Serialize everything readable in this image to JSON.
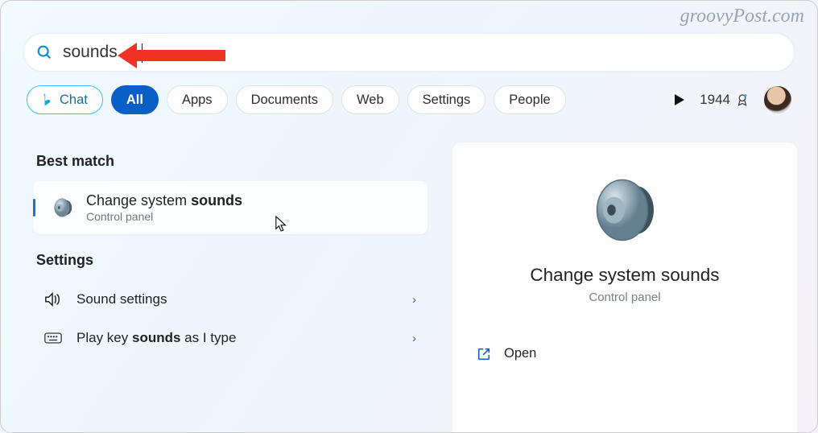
{
  "watermark": "groovyPost.com",
  "search": {
    "query": "sounds"
  },
  "filters": {
    "chat": "Chat",
    "all": "All",
    "apps": "Apps",
    "documents": "Documents",
    "web": "Web",
    "settings": "Settings",
    "people": "People"
  },
  "rewards": {
    "points": "1944"
  },
  "sections": {
    "best_match": "Best match",
    "settings": "Settings"
  },
  "best_match_item": {
    "title_prefix": "Change system ",
    "title_bold": "sounds",
    "subtitle": "Control panel"
  },
  "settings_items": [
    {
      "label": "Sound settings"
    },
    {
      "label_prefix": "Play key ",
      "label_bold": "sounds",
      "label_suffix": " as I type"
    }
  ],
  "detail": {
    "title": "Change system sounds",
    "subtitle": "Control panel",
    "open": "Open"
  }
}
